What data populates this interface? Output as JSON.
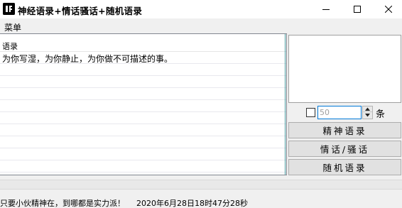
{
  "window": {
    "title": "神经语录+情话骚话+随机语录",
    "app_icon": "app-logo-icon",
    "controls": [
      "minimize-icon",
      "maximize-icon",
      "close-icon"
    ]
  },
  "menubar": {
    "items": [
      "菜单"
    ]
  },
  "list": {
    "column_header": "语录",
    "rows": [
      "为你写湿，为你静止，为你做不可描述的事。",
      "",
      "",
      "",
      "",
      "",
      "",
      "",
      "",
      ""
    ]
  },
  "side_panel": {
    "count_placeholder": "50",
    "count_unit": "条",
    "buttons": {
      "spirit": "精神语录",
      "love": "情话/骚话",
      "random": "随机语录"
    }
  },
  "statusbar": {
    "motto": "只要小伙精神在，到哪都是实力派！",
    "timestamp": "2020年6月28日18时47分28秒"
  },
  "colors": {
    "window_bg": "#f0f0f0",
    "titlebar_bg": "#ffffff",
    "button_bg": "#e1e1e1",
    "focus_border": "#0078d7"
  }
}
